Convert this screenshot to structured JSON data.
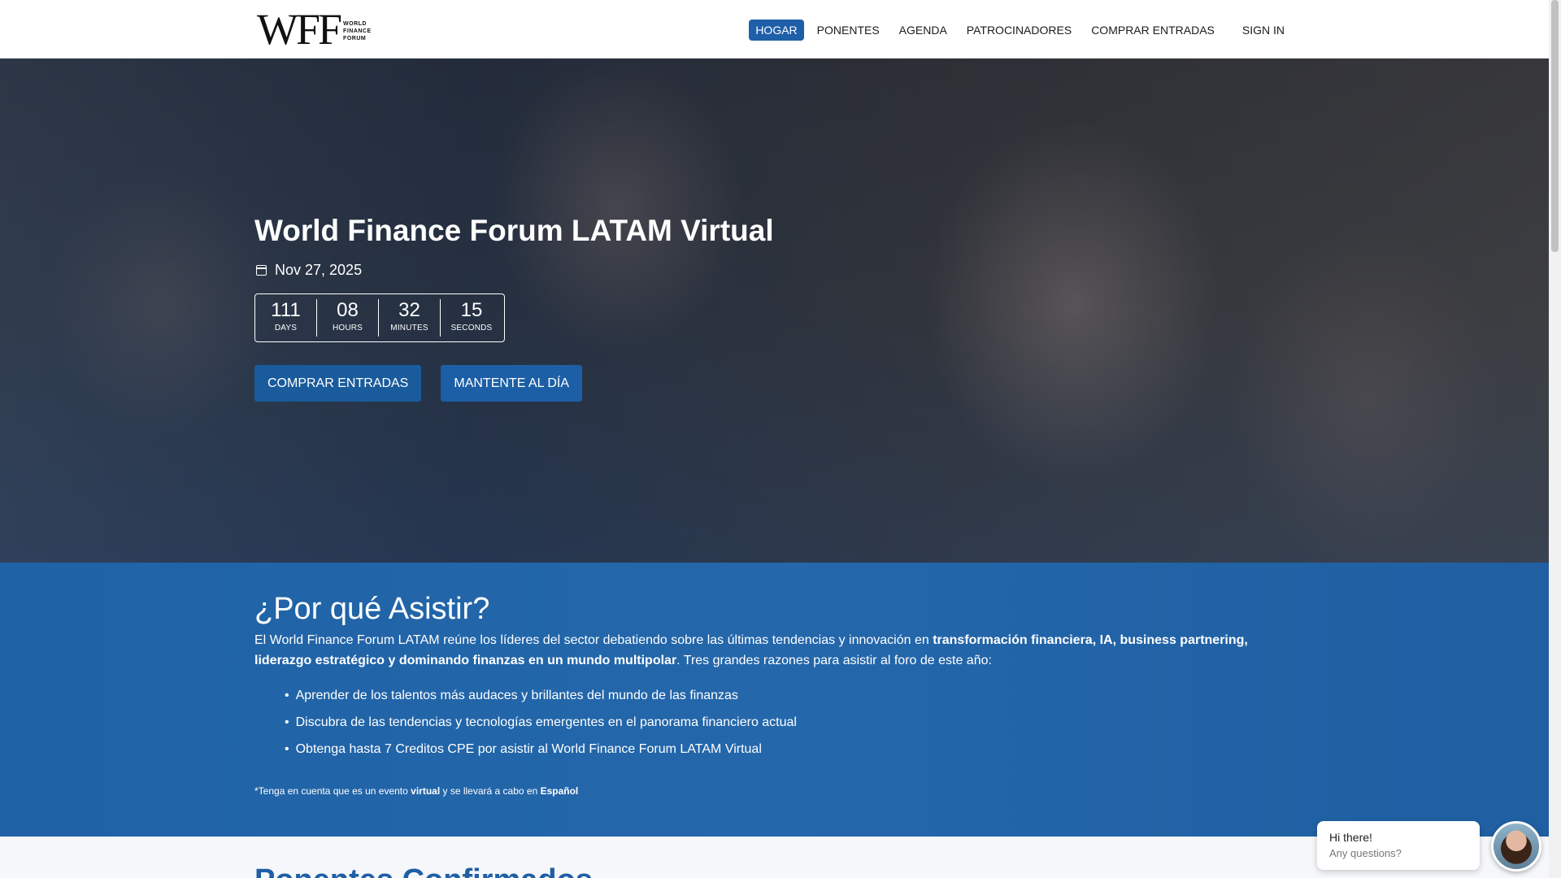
{
  "header": {
    "logo_mark": "WFF",
    "logo_sub": [
      "WORLD",
      "FINANCE",
      "FORUM"
    ],
    "nav": [
      {
        "label": "HOGAR",
        "active": true
      },
      {
        "label": "PONENTES",
        "active": false
      },
      {
        "label": "AGENDA",
        "active": false
      },
      {
        "label": "PATROCINADORES",
        "active": false
      },
      {
        "label": "COMPRAR ENTRADAS",
        "active": false
      }
    ],
    "signin_label": "SIGN IN"
  },
  "hero": {
    "title": "World Finance Forum LATAM Virtual",
    "date": "Nov 27, 2025",
    "date_icon": "calendar-icon",
    "countdown": [
      {
        "value": "111",
        "label": "DAYS"
      },
      {
        "value": "08",
        "label": "HOURS"
      },
      {
        "value": "32",
        "label": "MINUTES"
      },
      {
        "value": "15",
        "label": "SECONDS"
      }
    ],
    "buy_button": "COMPRAR ENTRADAS",
    "stay_button": "MANTENTE AL DÍA"
  },
  "why": {
    "title": "¿Por qué Asistir?",
    "intro_start": "El World Finance Forum LATAM reúne los líderes del sector debatiendo sobre las últimas tendencias y innovación en ",
    "intro_bold": "transformación financiera, IA, business partnering, liderazgo estratégico y dominando finanzas en un mundo multipolar",
    "intro_end": ". Tres grandes razones para asistir al foro de este año:",
    "reasons": [
      "Aprender de los talentos más audaces y brillantes del mundo de las finanzas",
      "Discubra de las tendencias y tecnologías emergentes en el panorama financiero actual",
      "Obtenga hasta 7 Creditos CPE por asistir al World Finance Forum LATAM Virtual"
    ],
    "note_1": "*Tenga en cuenta que es un evento ",
    "note_bold_1": "virtual",
    "note_2": " y se llevará a cabo en ",
    "note_bold_2": "Español"
  },
  "speakers": {
    "title": "Ponentes Confirmados"
  },
  "chat": {
    "greeting": "Hi there!",
    "prompt": "Any questions?"
  },
  "colors": {
    "accent": "#1f5fa8",
    "section_blue": "#2467ab"
  }
}
